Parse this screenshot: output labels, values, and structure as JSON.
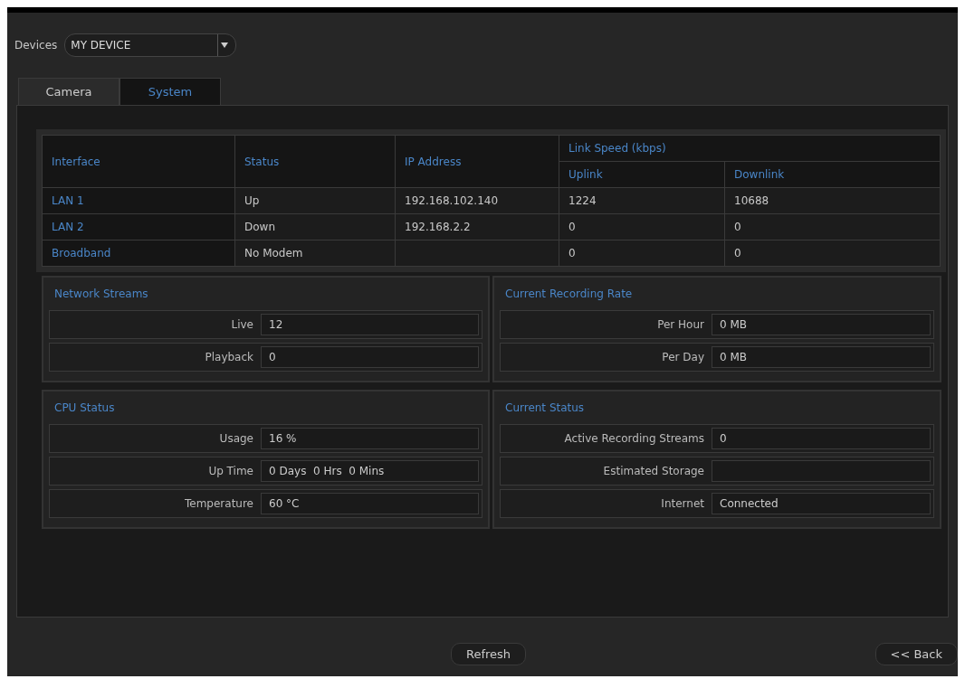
{
  "devices": {
    "label": "Devices",
    "value": "MY DEVICE"
  },
  "tabs": [
    {
      "label": "Camera",
      "selected": false
    },
    {
      "label": "System",
      "selected": true
    }
  ],
  "table": {
    "columns": [
      "Interface",
      "Status",
      "IP Address"
    ],
    "column_group": {
      "label": "Link Speed (kbps)",
      "columns": [
        "Uplink",
        "Downlink"
      ]
    },
    "rows": [
      {
        "interface": "LAN 1",
        "status": "Up",
        "ip_address": "192.168.102.140",
        "uplink": "1224",
        "downlink": "10688"
      },
      {
        "interface": "LAN 2",
        "status": "Down",
        "ip_address": "192.168.2.2",
        "uplink": "0",
        "downlink": "0"
      },
      {
        "interface": "Broadband",
        "status": "No Modem",
        "uplink": "0",
        "downlink": "0"
      }
    ]
  },
  "panels": [
    {
      "title": "Network Streams",
      "fields": [
        {
          "label": "Live",
          "value": "12"
        },
        {
          "label": "Playback",
          "value": "0"
        }
      ]
    },
    {
      "title": "Current Recording Rate",
      "fields": [
        {
          "label": "Per Hour",
          "value": "0 MB"
        },
        {
          "label": "Per Day",
          "value": "0 MB"
        }
      ]
    },
    {
      "title": "CPU Status",
      "fields": [
        {
          "label": "Usage",
          "value": "16 %"
        },
        {
          "label": "Up Time",
          "value": "0 Days  0 Hrs  0 Mins"
        },
        {
          "label": "Temperature",
          "value": "60 °C"
        }
      ]
    },
    {
      "title": "Current Status",
      "fields": [
        {
          "label": "Active Recording Streams",
          "value": "0"
        },
        {
          "label": "Estimated Storage"
        },
        {
          "label": "Internet",
          "value": "Connected"
        }
      ]
    }
  ],
  "buttons": {
    "refresh": "Refresh",
    "back": "<< Back"
  }
}
